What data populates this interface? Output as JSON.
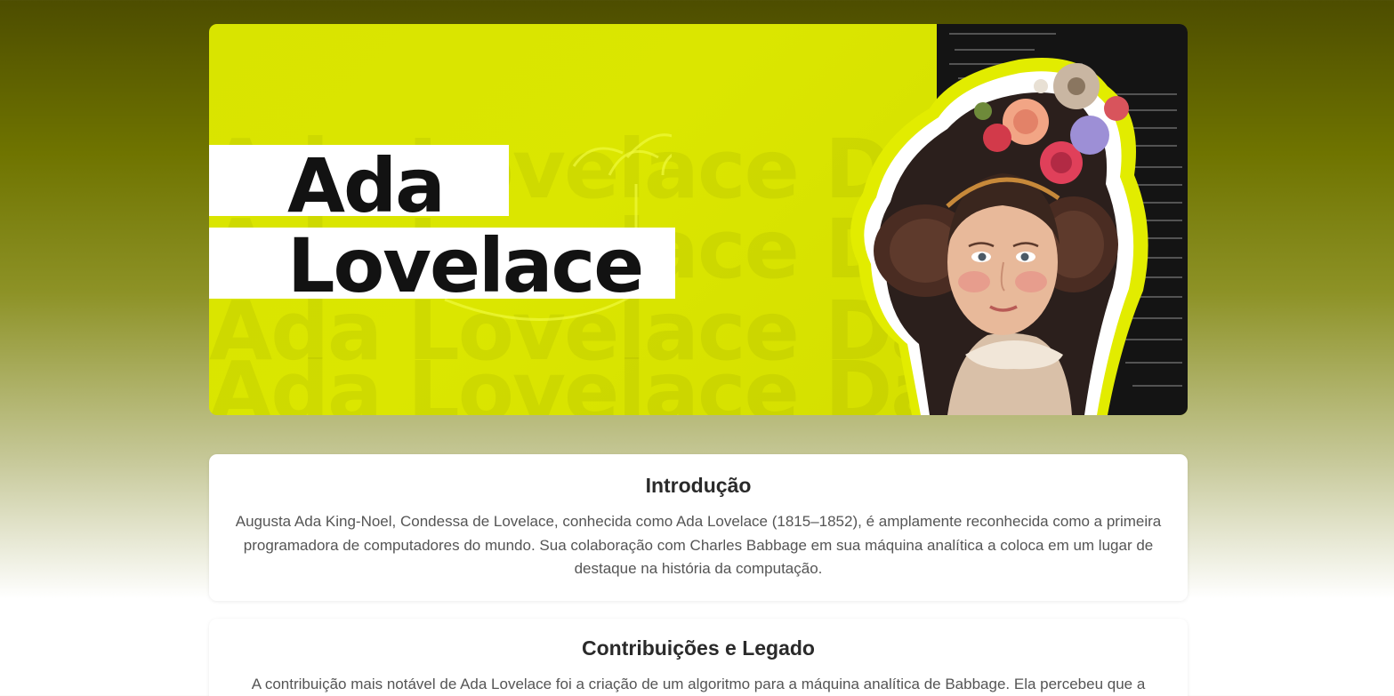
{
  "hero": {
    "title_line1": "Ada",
    "title_line2": "Lovelace",
    "watermark_line1": "Ada Lovelace Day",
    "watermark_line2": "Ada Lovelace Day",
    "watermark_line3": "Ada Lovelace Day",
    "accent_color": "#d9e400"
  },
  "sections": [
    {
      "heading": "Introdução",
      "text": "Augusta Ada King-Noel, Condessa de Lovelace, conhecida como Ada Lovelace (1815–1852), é amplamente reconhecida como a primeira programadora de computadores do mundo. Sua colaboração com Charles Babbage em sua máquina analítica a coloca em um lugar de destaque na história da computação."
    },
    {
      "heading": "Contribuições e Legado",
      "text": "A contribuição mais notável de Ada Lovelace foi a criação de um algoritmo para a máquina analítica de Babbage. Ela percebeu que a"
    }
  ]
}
